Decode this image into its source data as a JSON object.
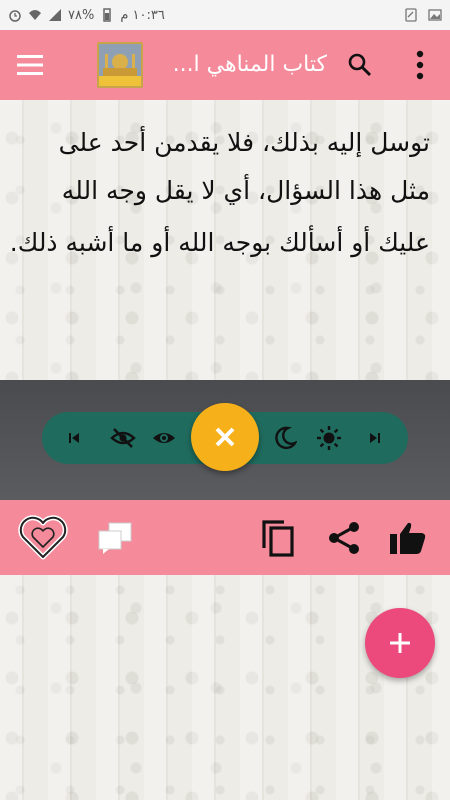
{
  "status_bar": {
    "time": "١٠:٣٦ م",
    "battery": "%٧٨",
    "icons": [
      "battery-icon",
      "signal-icon",
      "wifi-icon",
      "alarm-icon",
      "notification-icon",
      "image-icon"
    ]
  },
  "app_bar": {
    "title": "كتاب المناهي ا...",
    "logo_icon": "mosque-logo-icon",
    "menu_icon": "hamburger-menu-icon",
    "search_icon": "search-icon",
    "more_icon": "more-vert-icon",
    "color": "#f48a9a"
  },
  "reader": {
    "lines": [
      "توسل إليه بذلك، فلا يقدمن أحد على",
      "مثل هذا السؤال، أي لا يقل وجه الله",
      "عليك أو أسألك بوجه الله أو ما أشبه ذلك."
    ]
  },
  "controls": {
    "pill_color": "#1f6b5e",
    "fab_color": "#f6b01a",
    "buttons": [
      "previous-icon",
      "visibility-off-icon",
      "visibility-icon",
      "close-icon",
      "night-mode-icon",
      "brightness-icon",
      "next-icon"
    ]
  },
  "actions": {
    "buttons": [
      "favorite-heart-icon",
      "comments-icon",
      "copy-icon",
      "share-icon",
      "thumbs-up-icon"
    ],
    "fab_color": "#ec4a7c",
    "fab_icon": "add-icon"
  }
}
